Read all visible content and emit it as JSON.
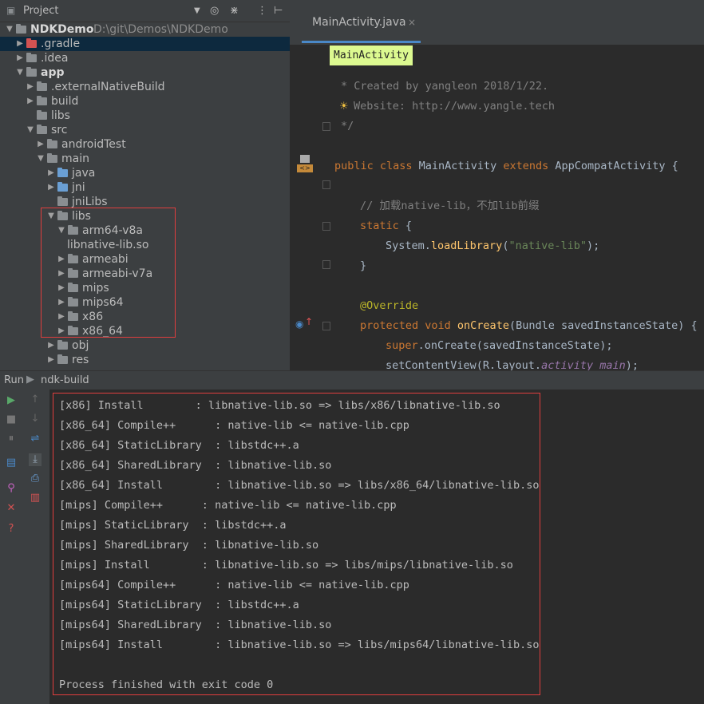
{
  "project_panel": {
    "title": "Project",
    "icons": [
      "chevron-down-icon",
      "target-icon",
      "collapse-icon",
      "gear-icon",
      "hide-icon"
    ]
  },
  "project_tree": [
    {
      "label": "NDKDemo",
      "path": "D:\\git\\Demos\\NDKDemo",
      "expanded": true,
      "icon": "module"
    },
    {
      "label": ".gradle",
      "expanded": false,
      "icon": "red",
      "selected": true
    },
    {
      "label": ".idea",
      "expanded": false,
      "icon": "folder"
    },
    {
      "label": "app",
      "expanded": true,
      "icon": "module"
    },
    {
      "label": ".externalNativeBuild",
      "expanded": false,
      "icon": "folder"
    },
    {
      "label": "build",
      "expanded": false,
      "icon": "folder"
    },
    {
      "label": "libs",
      "icon": "folder"
    },
    {
      "label": "src",
      "expanded": true,
      "icon": "folder"
    },
    {
      "label": "androidTest",
      "expanded": false,
      "icon": "folder"
    },
    {
      "label": "main",
      "expanded": true,
      "icon": "folder"
    },
    {
      "label": "java",
      "expanded": false,
      "icon": "blue"
    },
    {
      "label": "jni",
      "expanded": false,
      "icon": "blue"
    },
    {
      "label": "jniLibs",
      "icon": "folder"
    },
    {
      "label": "libs",
      "expanded": true,
      "icon": "folder"
    },
    {
      "label": "arm64-v8a",
      "expanded": true,
      "icon": "folder"
    },
    {
      "label": "libnative-lib.so",
      "icon": "file"
    },
    {
      "label": "armeabi",
      "expanded": false,
      "icon": "folder"
    },
    {
      "label": "armeabi-v7a",
      "expanded": false,
      "icon": "folder"
    },
    {
      "label": "mips",
      "expanded": false,
      "icon": "folder"
    },
    {
      "label": "mips64",
      "expanded": false,
      "icon": "folder"
    },
    {
      "label": "x86",
      "expanded": false,
      "icon": "folder"
    },
    {
      "label": "x86_64",
      "expanded": false,
      "icon": "folder"
    },
    {
      "label": "obj",
      "expanded": false,
      "icon": "folder"
    },
    {
      "label": "res",
      "expanded": false,
      "icon": "folder"
    }
  ],
  "editor": {
    "tab": "MainActivity.java",
    "breadcrumb": "MainActivity",
    "lines": [
      {
        "parts": [
          {
            "t": " * Created by ",
            "c": "cm"
          },
          {
            "t": "yangle",
            "c": "cm"
          },
          {
            "t": " on 2018/1/22.",
            "c": "cm"
          }
        ]
      },
      {
        "parts": [
          {
            "t": "Website: http://www.yangle.tech",
            "c": "cm"
          }
        ]
      },
      {
        "parts": [
          {
            "t": " */",
            "c": "cm"
          }
        ]
      },
      {
        "parts": []
      },
      {
        "parts": [
          {
            "t": "public class ",
            "c": "kw"
          },
          {
            "t": "MainActivity ",
            "c": ""
          },
          {
            "t": "extends ",
            "c": "kw"
          },
          {
            "t": "AppCompatActivity {",
            "c": ""
          }
        ]
      },
      {
        "parts": []
      },
      {
        "parts": [
          {
            "t": "    // 加载native-lib，不加lib前缀",
            "c": "cm"
          }
        ]
      },
      {
        "parts": [
          {
            "t": "    static ",
            "c": "kw"
          },
          {
            "t": "{",
            "c": ""
          }
        ]
      },
      {
        "parts": [
          {
            "t": "        System.",
            "c": ""
          },
          {
            "t": "loadLibrary",
            "c": "fn"
          },
          {
            "t": "(",
            "c": ""
          },
          {
            "t": "\"native-lib\"",
            "c": "str"
          },
          {
            "t": ");",
            "c": ""
          }
        ]
      },
      {
        "parts": [
          {
            "t": "    }",
            "c": ""
          }
        ]
      },
      {
        "parts": []
      },
      {
        "parts": [
          {
            "t": "    @Override",
            "c": "ann"
          }
        ]
      },
      {
        "parts": [
          {
            "t": "    protected void ",
            "c": "kw"
          },
          {
            "t": "onCreate",
            "c": "fn"
          },
          {
            "t": "(Bundle savedInstanceState) {",
            "c": ""
          }
        ]
      },
      {
        "parts": [
          {
            "t": "        super",
            "c": "kw"
          },
          {
            "t": ".onCreate(savedInstanceState);",
            "c": ""
          }
        ]
      },
      {
        "parts": [
          {
            "t": "        setContentView(R.layout.",
            "c": ""
          },
          {
            "t": "activity_main",
            "c": "fld"
          },
          {
            "t": ");",
            "c": ""
          }
        ]
      }
    ]
  },
  "run": {
    "label": "Run",
    "config": "ndk-build",
    "output": [
      "[x86] Install        : libnative-lib.so => libs/x86/libnative-lib.so",
      "[x86_64] Compile++      : native-lib <= native-lib.cpp",
      "[x86_64] StaticLibrary  : libstdc++.a",
      "[x86_64] SharedLibrary  : libnative-lib.so",
      "[x86_64] Install        : libnative-lib.so => libs/x86_64/libnative-lib.so",
      "[mips] Compile++      : native-lib <= native-lib.cpp",
      "[mips] StaticLibrary  : libstdc++.a",
      "[mips] SharedLibrary  : libnative-lib.so",
      "[mips] Install        : libnative-lib.so => libs/mips/libnative-lib.so",
      "[mips64] Compile++      : native-lib <= native-lib.cpp",
      "[mips64] StaticLibrary  : libstdc++.a",
      "[mips64] SharedLibrary  : libnative-lib.so",
      "[mips64] Install        : libnative-lib.so => libs/mips64/libnative-lib.so",
      "",
      "Process finished with exit code 0"
    ]
  },
  "colors": {
    "selection": "#0d293e",
    "highlight_box": "#e03e3e",
    "breadcrumb_bg": "#dcf990"
  }
}
